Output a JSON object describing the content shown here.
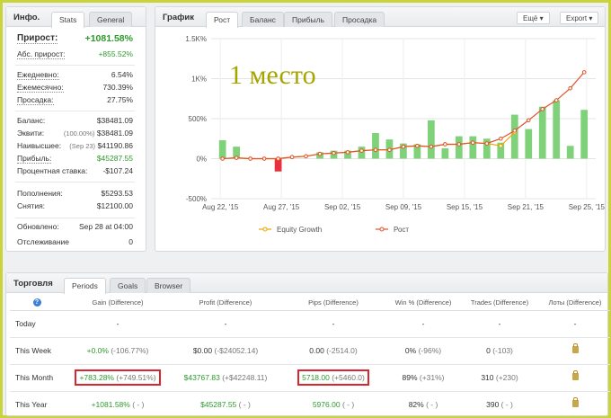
{
  "info": {
    "title": "Инфо.",
    "tabs": [
      "Stats",
      "General"
    ],
    "growth_label": "Прирост:",
    "growth_value": "+1081.58%",
    "abs_label": "Абс. прирост:",
    "abs_value": "+855.52%",
    "daily_label": "Ежедневно:",
    "daily_value": "6.54%",
    "monthly_label": "Ежемесячно:",
    "monthly_value": "730.39%",
    "dd_label": "Просадка:",
    "dd_value": "27.75%",
    "balance_label": "Баланс:",
    "balance_value": "$38481.09",
    "equity_label": "Эквити:",
    "equity_pct": "(100.00%)",
    "equity_value": "$38481.09",
    "high_label": "Наивысшее:",
    "high_date": "(Sep 23)",
    "high_value": "$41190.86",
    "profit_label": "Прибыль:",
    "profit_value": "$45287.55",
    "interest_label": "Процентная ставка:",
    "interest_value": "-$107.24",
    "deposits_label": "Пополнения:",
    "deposits_value": "$5293.53",
    "withdrawals_label": "Снятия:",
    "withdrawals_value": "$12100.00",
    "updated_label": "Обновлено:",
    "updated_value": "Sep 28 at 04:00",
    "tracking_label": "Отслеживание",
    "tracking_value": "0"
  },
  "chart_panel": {
    "title": "График",
    "tabs": [
      "Рост",
      "Баланс",
      "Прибыль",
      "Просадка"
    ],
    "more_label": "Ещё",
    "export_label": "Export",
    "overlay_text": "1 место"
  },
  "chart_data": {
    "type": "bar",
    "title": "",
    "yticks": [
      "1.5K%",
      "1K%",
      "500%",
      "0%",
      "-500%"
    ],
    "ylim": [
      -500,
      1500
    ],
    "xticks": [
      "Aug 22, '15",
      "Aug 27, '15",
      "Sep 02, '15",
      "Sep 09, '15",
      "Sep 15, '15",
      "Sep 21, '15",
      "Sep 25, '15"
    ],
    "bars": [
      230,
      150,
      0,
      0,
      -160,
      0,
      0,
      80,
      100,
      100,
      150,
      320,
      240,
      190,
      180,
      480,
      130,
      280,
      280,
      250,
      200,
      550,
      370,
      650,
      730,
      160,
      610
    ],
    "series": [
      {
        "name": "Equity Growth",
        "color": "#f0a500",
        "values": [
          0,
          10,
          0,
          0,
          0,
          20,
          30,
          60,
          70,
          80,
          100,
          110,
          110,
          150,
          160,
          150,
          180,
          180,
          200,
          190,
          160,
          330
        ]
      },
      {
        "name": "Рост",
        "color": "#e0522a",
        "values": [
          0,
          10,
          0,
          0,
          0,
          20,
          30,
          60,
          70,
          80,
          100,
          110,
          110,
          150,
          160,
          150,
          180,
          180,
          200,
          190,
          250,
          350,
          480,
          620,
          730,
          880,
          1080
        ]
      }
    ],
    "grid": true,
    "legend_position": "bottom"
  },
  "trading": {
    "title": "Торговля",
    "tabs": [
      "Periods",
      "Goals",
      "Browser"
    ],
    "help_icon": "question-icon",
    "columns": [
      "Gain (Difference)",
      "Profit (Difference)",
      "Pips (Difference)",
      "Win % (Difference)",
      "Trades (Difference)",
      "Лоты (Difference)"
    ],
    "rows": [
      {
        "period": "Today",
        "gain": "-",
        "gain_diff": "",
        "profit": "-",
        "profit_diff": "",
        "pips": "-",
        "pips_diff": "",
        "win": "-",
        "win_diff": "",
        "trades": "-",
        "trades_diff": "",
        "lots": "-"
      },
      {
        "period": "This Week",
        "gain": "+0.0%",
        "gain_diff": "(-106.77%)",
        "profit": "$0.00",
        "profit_diff": "(-$24052.14)",
        "pips": "0.00",
        "pips_diff": "(-2514.0)",
        "win": "0%",
        "win_diff": "(-96%)",
        "trades": "0",
        "trades_diff": "(-103)",
        "lots": "lock-icon"
      },
      {
        "period": "This Month",
        "gain": "+783.28%",
        "gain_diff": "(+749.51%)",
        "profit": "$43767.83",
        "profit_diff": "(+$42248.11)",
        "pips": "5718.00",
        "pips_diff": "(+5460.0)",
        "win": "89%",
        "win_diff": "(+31%)",
        "trades": "310",
        "trades_diff": "(+230)",
        "lots": "lock-icon"
      },
      {
        "period": "This Year",
        "gain": "+1081.58%",
        "gain_diff": "( - )",
        "profit": "$45287.55",
        "profit_diff": "( - )",
        "pips": "5976.00",
        "pips_diff": "( - )",
        "win": "82%",
        "win_diff": "( - )",
        "trades": "390",
        "trades_diff": "( - )",
        "lots": "lock-icon"
      }
    ]
  }
}
